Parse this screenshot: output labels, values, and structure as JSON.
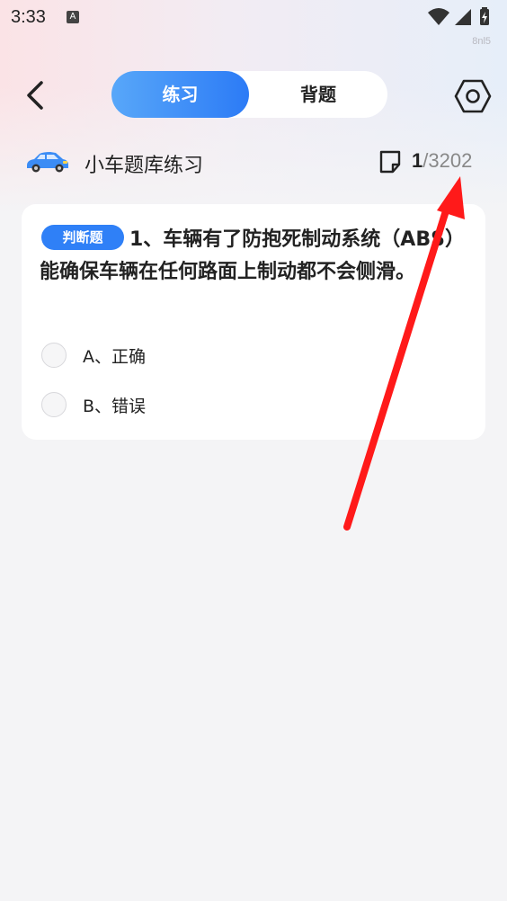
{
  "status_bar": {
    "time": "3:33",
    "notification_badge": "A",
    "watermark": "8nl5"
  },
  "header": {
    "tabs": [
      {
        "label": "练习",
        "active": true
      },
      {
        "label": "背题",
        "active": false
      }
    ]
  },
  "bank": {
    "title": "小车题库练习",
    "current": "1",
    "total_text": "/3202"
  },
  "question": {
    "type_badge": "判断题",
    "text": "1、车辆有了防抱死制动系统（ABS）能确保车辆在任何路面上制动都不会侧滑。",
    "options": [
      {
        "label": "A、正确"
      },
      {
        "label": "B、错误"
      }
    ]
  },
  "colors": {
    "accent": "#2f80f7",
    "arrow": "#ff1a1a"
  }
}
